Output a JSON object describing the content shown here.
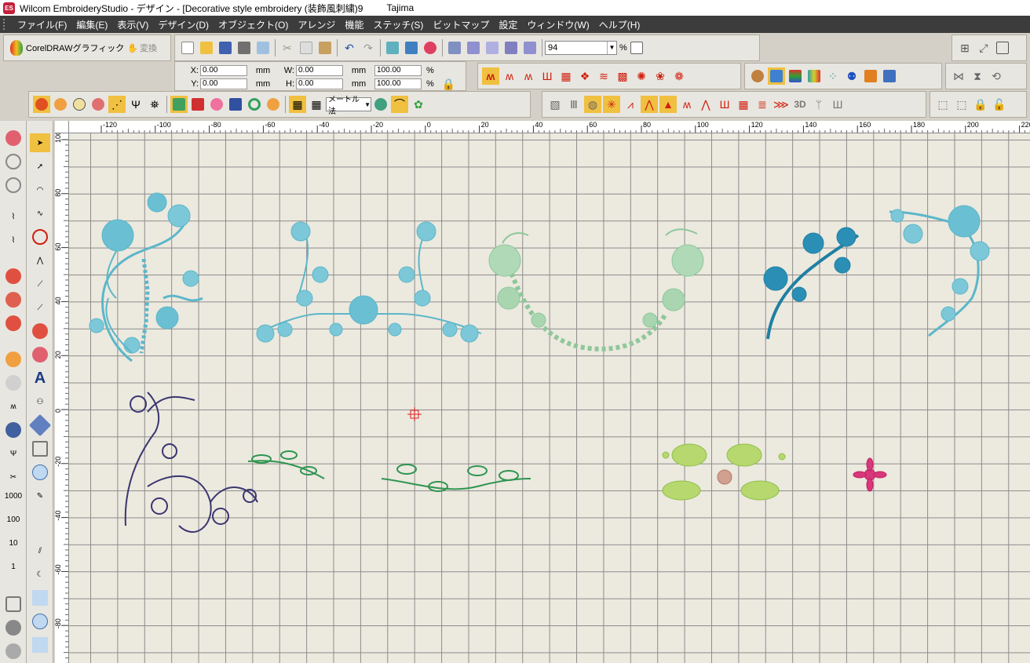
{
  "window": {
    "app_icon_text": "ES",
    "title": "Wilcom EmbroideryStudio - デザイン - [Decorative style embroidery (装飾風刺繍)9",
    "machine": "Tajima"
  },
  "menu": {
    "items": [
      "ファイル(F)",
      "編集(E)",
      "表示(V)",
      "デザイン(D)",
      "オブジェクト(O)",
      "アレンジ",
      "機能",
      "ステッチ(S)",
      "ビットマップ",
      "設定",
      "ウィンドウ(W)",
      "ヘルプ(H)"
    ]
  },
  "toolbar": {
    "coreldraw_label": "CorelDRAWグラフィック",
    "convert_label": "変換",
    "zoom_value": "94",
    "zoom_unit": "%"
  },
  "coords": {
    "x_label": "X:",
    "x_value": "0.00",
    "x_unit": "mm",
    "y_label": "Y:",
    "y_value": "0.00",
    "y_unit": "mm",
    "w_label": "W:",
    "w_value": "0.00",
    "w_unit": "mm",
    "h_label": "H:",
    "h_value": "0.00",
    "h_unit": "mm",
    "w_pct": "100.00",
    "h_pct": "100.00",
    "pct_unit": "%"
  },
  "object_toolbar": {
    "method_combo": "メートル法"
  },
  "left_toolbar": {
    "labels": [
      "1000",
      "100",
      "10",
      "1"
    ],
    "text_tool": "A"
  },
  "stitch_toolbar": {
    "label_3d": "3D"
  },
  "ruler": {
    "top_ticks": [
      "-120",
      "-100",
      "-80",
      "-60",
      "-40",
      "-20",
      "0",
      "20",
      "40",
      "60",
      "80",
      "100",
      "120",
      "140",
      "160",
      "180",
      "200",
      "220"
    ],
    "left_ticks": [
      "100",
      "80",
      "60",
      "40",
      "20",
      "0",
      "-20",
      "-40",
      "-60",
      "-80"
    ]
  },
  "colors": {
    "teal": "#5bb7c9",
    "dark_teal": "#1f7fa3",
    "mint": "#9fd2a9",
    "navy": "#3a3670",
    "green": "#2f9550",
    "lime": "#a8d060",
    "pink": "#d8387a",
    "origin_marker": "#e02020"
  },
  "designs": [
    "teal-floral-corner-left",
    "teal-floral-border",
    "mint-floral-swag",
    "dark-teal-branch",
    "teal-floral-corner-right",
    "navy-scroll-vine",
    "green-leaf-sprig-small",
    "green-leaf-sprig-long",
    "lime-leaf-cluster",
    "pink-flower"
  ]
}
